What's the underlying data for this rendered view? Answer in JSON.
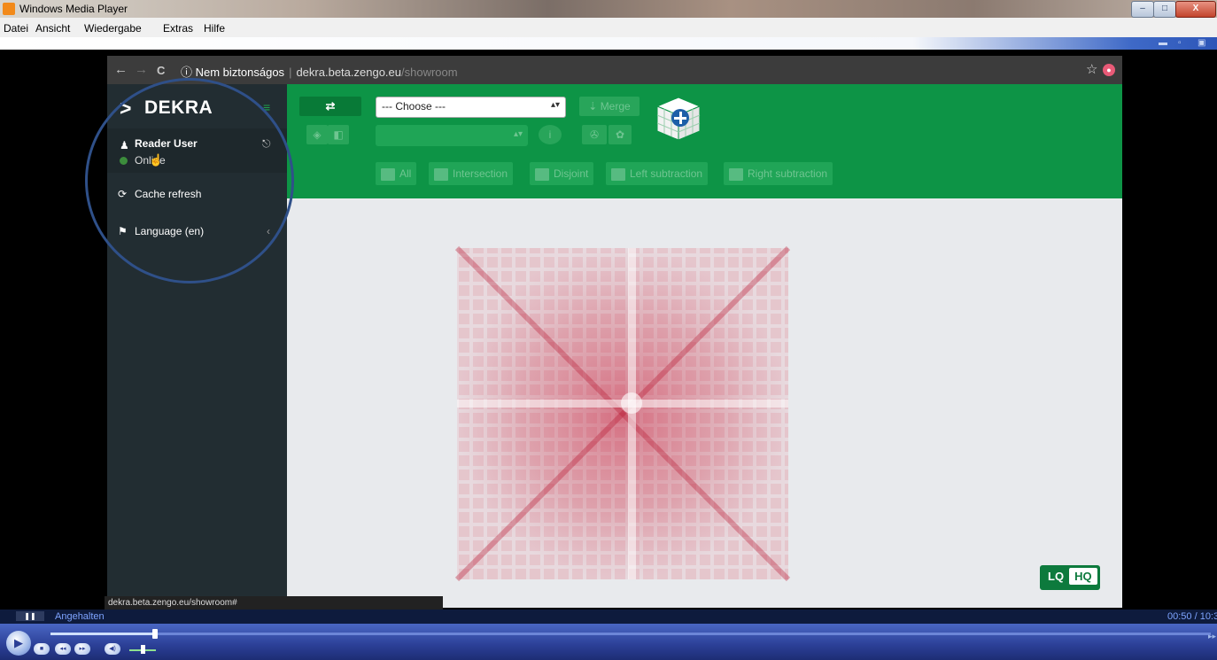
{
  "wmp": {
    "title": "Windows Media Player",
    "menu": [
      "Datei",
      "Ansicht",
      "Wiedergabe",
      "Extras",
      "Hilfe"
    ],
    "window_buttons": {
      "minimize": "–",
      "maximize": "□",
      "close": "X"
    },
    "status": "Angehalten",
    "pause_label": "❚❚",
    "time": "00:50 / 10:3",
    "seek_progress": 0.09,
    "volume": 0.5
  },
  "browser": {
    "back": "←",
    "forward": "→",
    "reload": "C",
    "security": "ⓘ Nem biztonságos",
    "host": "dekra.beta.zengo.eu",
    "path": "/showroom",
    "star": "☆",
    "status_url": "dekra.beta.zengo.eu/showroom#"
  },
  "app": {
    "brand": "DEKRA",
    "user_name": "Reader User",
    "user_status": "Online",
    "menu": [
      {
        "icon": "refresh-icon",
        "label": "Cache refresh"
      },
      {
        "icon": "flag-icon",
        "label": "Language (en)"
      }
    ],
    "toolbar": {
      "select_value": "--- Choose ---",
      "merge_label": "Merge",
      "ops": [
        "All",
        "Intersection",
        "Disjoint",
        "Left subtraction",
        "Right subtraction"
      ]
    },
    "quality": {
      "lq": "LQ",
      "hq": "HQ",
      "active": "HQ"
    }
  },
  "colors": {
    "toolbar_green": "#0d9446",
    "sidebar": "#222d32",
    "viewport": "#e8eaed",
    "annotation_circle": "#2f5089",
    "render_red": "#c81e3a"
  }
}
